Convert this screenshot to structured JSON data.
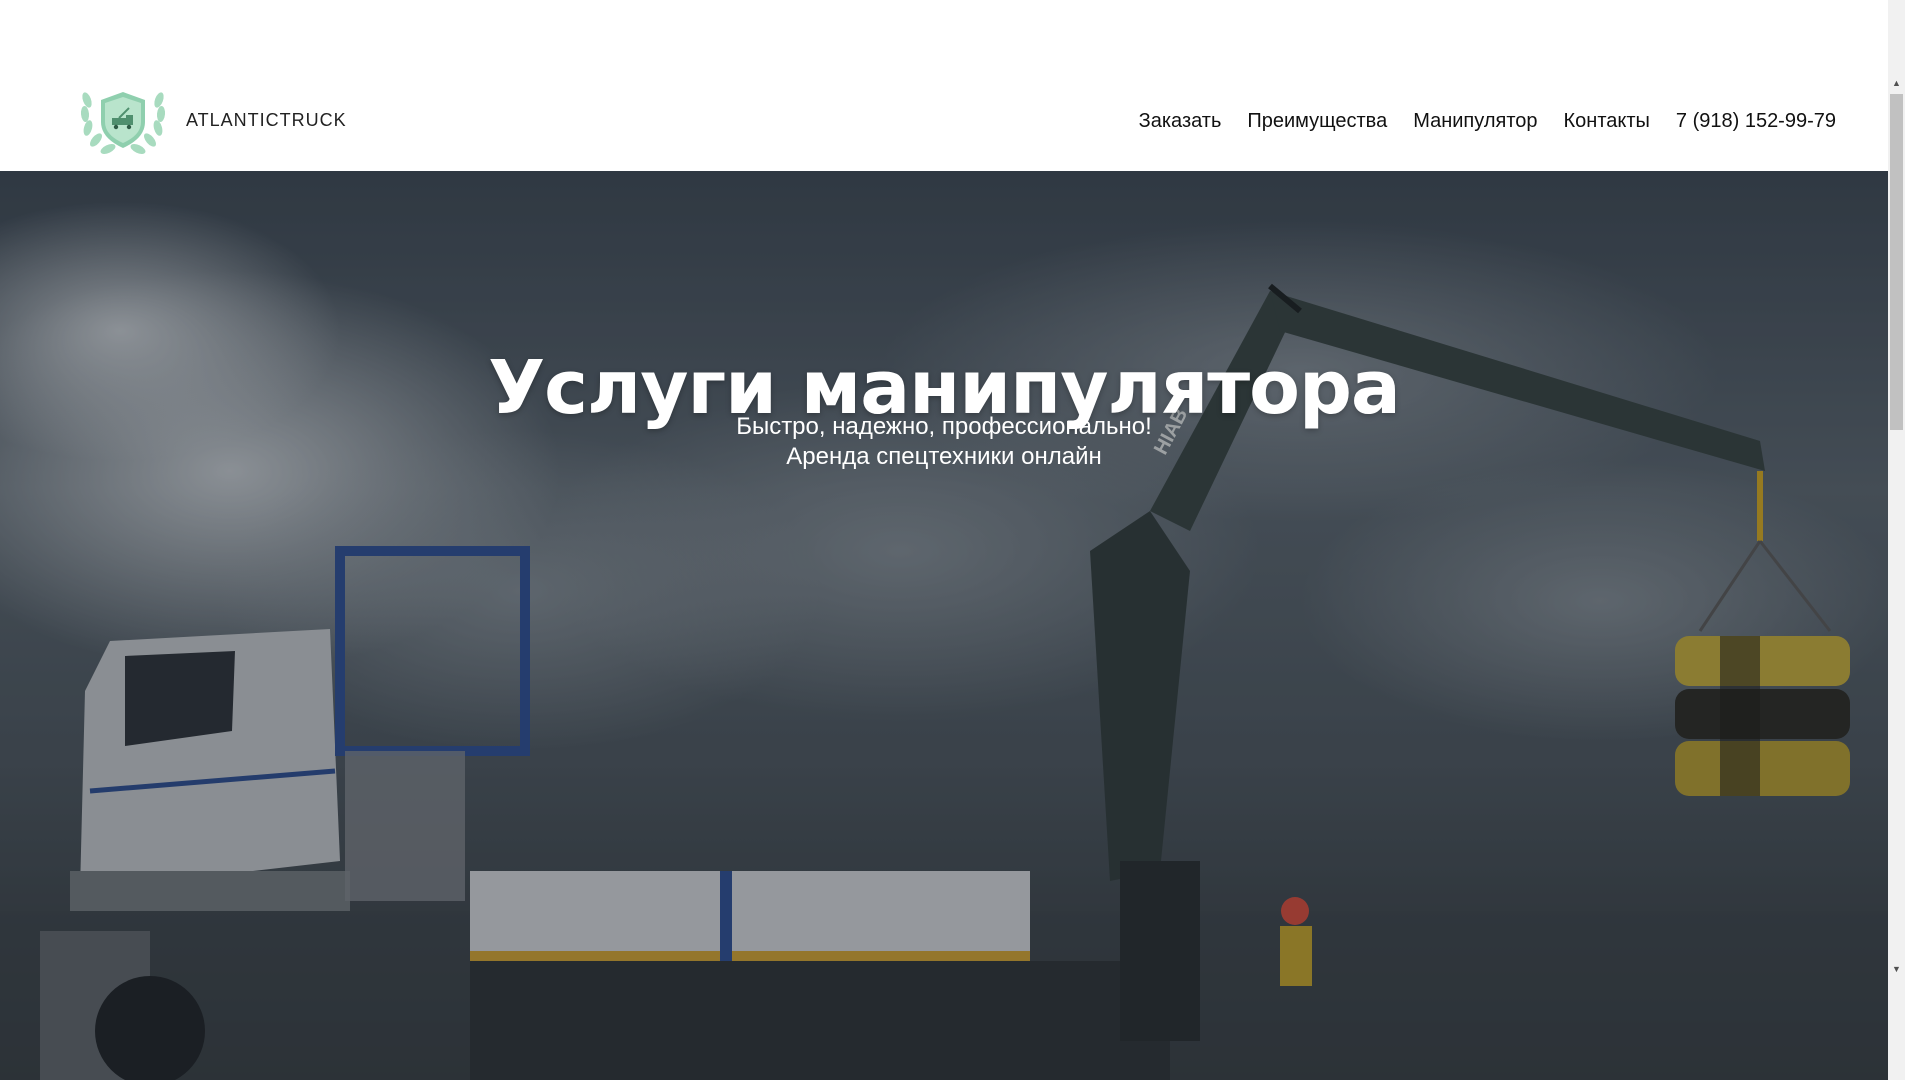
{
  "brand": {
    "name": "ATLANTICTRUCK",
    "logo_icon": "laurel-shield-truck-icon",
    "logo_color": "#9fd4b8"
  },
  "nav": {
    "items": [
      {
        "label": "Заказать"
      },
      {
        "label": "Преимущества"
      },
      {
        "label": "Манипулятор"
      },
      {
        "label": "Контакты"
      },
      {
        "label": "7 (918) 152-99-79"
      }
    ]
  },
  "hero": {
    "title": "Услуги манипулятора",
    "subtitle_line1": "Быстро, надежно, профессионально!",
    "subtitle_line2": "Аренда спецтехники онлайн",
    "background_image": "crane-truck-photo"
  },
  "scrollbar": {
    "up_icon": "arrow-up-icon",
    "down_icon": "arrow-down-icon"
  }
}
